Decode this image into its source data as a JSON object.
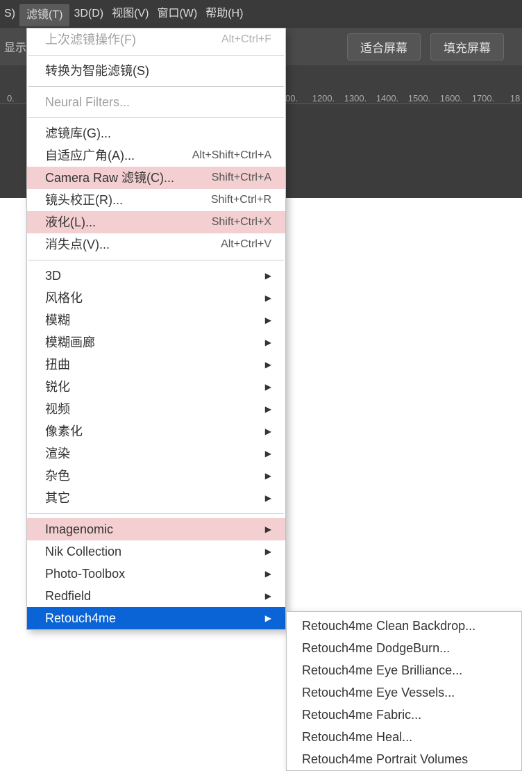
{
  "menubar": {
    "frag_left": "S)",
    "items": [
      "滤镜(T)",
      "3D(D)",
      "视图(V)",
      "窗口(W)",
      "帮助(H)"
    ],
    "open_index": 0
  },
  "toolbar": {
    "frag_left": "显示",
    "buttons": [
      "适合屏幕",
      "填充屏幕"
    ]
  },
  "ruler": {
    "left_frag": "0.",
    "right_labels": [
      "00.",
      "1200.",
      "1300.",
      "1400.",
      "1500.",
      "1600.",
      "1700.",
      "18"
    ]
  },
  "menu": {
    "group1": [
      {
        "label": "上次滤镜操作(F)",
        "shortcut": "Alt+Ctrl+F",
        "disabled": true
      }
    ],
    "group2": [
      {
        "label": "转换为智能滤镜(S)",
        "shortcut": ""
      }
    ],
    "group3": [
      {
        "label": "Neural Filters...",
        "shortcut": "",
        "disabled": true
      }
    ],
    "group4": [
      {
        "label": "滤镜库(G)...",
        "shortcut": ""
      },
      {
        "label": "自适应广角(A)...",
        "shortcut": "Alt+Shift+Ctrl+A"
      },
      {
        "label": "Camera Raw 滤镜(C)...",
        "shortcut": "Shift+Ctrl+A",
        "pink": true
      },
      {
        "label": "镜头校正(R)...",
        "shortcut": "Shift+Ctrl+R"
      },
      {
        "label": "液化(L)...",
        "shortcut": "Shift+Ctrl+X",
        "pink": true
      },
      {
        "label": "消失点(V)...",
        "shortcut": "Alt+Ctrl+V"
      }
    ],
    "group5": [
      {
        "label": "3D",
        "sub": true
      },
      {
        "label": "风格化",
        "sub": true
      },
      {
        "label": "模糊",
        "sub": true
      },
      {
        "label": "模糊画廊",
        "sub": true
      },
      {
        "label": "扭曲",
        "sub": true
      },
      {
        "label": "锐化",
        "sub": true
      },
      {
        "label": "视频",
        "sub": true
      },
      {
        "label": "像素化",
        "sub": true
      },
      {
        "label": "渲染",
        "sub": true
      },
      {
        "label": "杂色",
        "sub": true
      },
      {
        "label": "其它",
        "sub": true
      }
    ],
    "group6": [
      {
        "label": "Imagenomic",
        "sub": true,
        "pink": true
      },
      {
        "label": "Nik Collection",
        "sub": true
      },
      {
        "label": "Photo-Toolbox",
        "sub": true
      },
      {
        "label": "Redfield",
        "sub": true
      },
      {
        "label": "Retouch4me",
        "sub": true,
        "selected": true
      }
    ]
  },
  "submenu": {
    "items": [
      "Retouch4me Clean Backdrop...",
      "Retouch4me DodgeBurn...",
      "Retouch4me Eye Brilliance...",
      "Retouch4me Eye Vessels...",
      "Retouch4me Fabric...",
      "Retouch4me Heal...",
      "Retouch4me Portrait Volumes"
    ]
  }
}
